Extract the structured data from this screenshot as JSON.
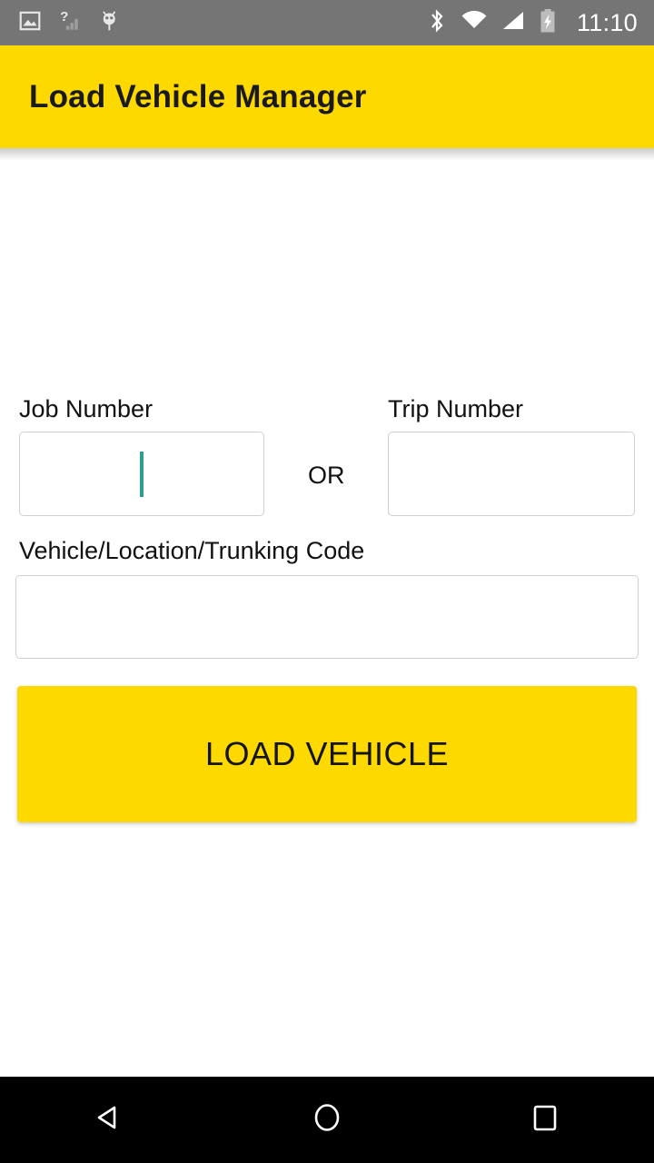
{
  "status_bar": {
    "background_color": "#757575",
    "time": "11:10",
    "left_icons": [
      {
        "name": "image-icon",
        "label": "screenshot"
      },
      {
        "name": "signal-question-icon",
        "label": "no-sim-signal"
      },
      {
        "name": "android-debug-icon",
        "label": "usb-debugging"
      }
    ],
    "right_icons": [
      {
        "name": "bluetooth-icon",
        "label": "bluetooth"
      },
      {
        "name": "wifi-icon",
        "label": "wifi"
      },
      {
        "name": "cellular-signal-icon",
        "label": "cellular"
      },
      {
        "name": "battery-charging-icon",
        "label": "battery-charging"
      }
    ]
  },
  "app_bar": {
    "title": "Load Vehicle Manager",
    "background_color": "#FDD900",
    "text_color": "#1A1A1A"
  },
  "form": {
    "job_number": {
      "label": "Job Number",
      "value": "",
      "placeholder": "",
      "focused": true,
      "caret_color": "#2E9E8F"
    },
    "separator": "OR",
    "trip_number": {
      "label": "Trip Number",
      "value": "",
      "placeholder": "",
      "focused": false
    },
    "vehicle_code": {
      "label": "Vehicle/Location/Trunking Code",
      "value": "",
      "placeholder": "",
      "focused": false
    },
    "submit": {
      "label": "LOAD VEHICLE",
      "background_color": "#FDD900",
      "text_color": "#141414"
    }
  },
  "nav_bar": {
    "background_color": "#000000",
    "buttons": [
      {
        "name": "back-button",
        "icon": "triangle-left-icon"
      },
      {
        "name": "home-button",
        "icon": "circle-icon"
      },
      {
        "name": "recents-button",
        "icon": "square-icon"
      }
    ]
  }
}
